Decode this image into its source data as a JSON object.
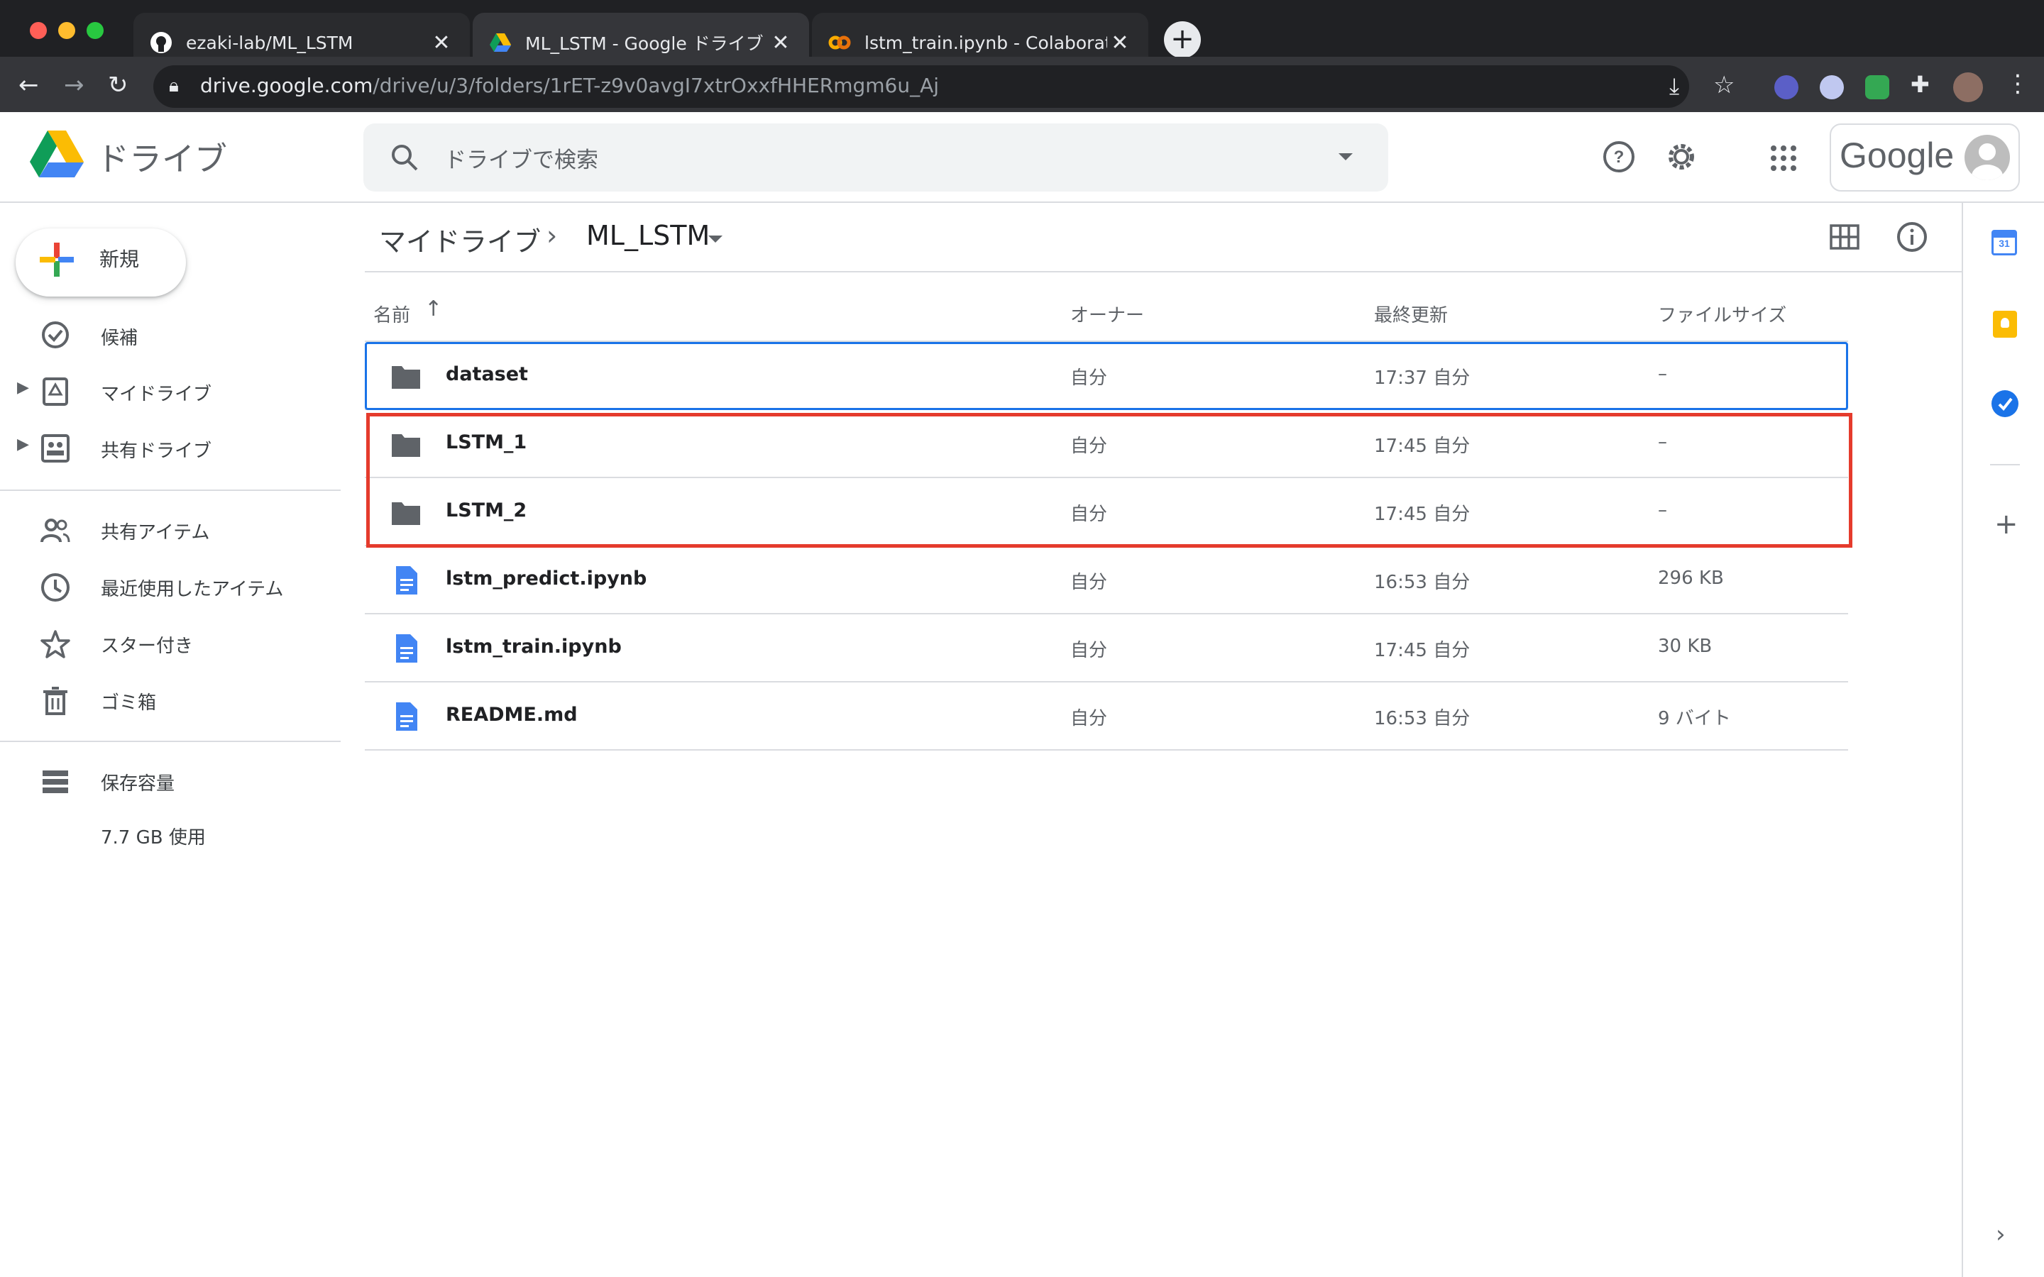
{
  "browser": {
    "tabs": [
      {
        "title": "ezaki-lab/ML_LSTM",
        "icon": "github-icon"
      },
      {
        "title": "ML_LSTM - Google ドライブ",
        "icon": "google-drive-icon"
      },
      {
        "title": "lstm_train.ipynb - Colaboratory",
        "icon": "colab-icon"
      }
    ],
    "url_host": "drive.google.com",
    "url_path": "/drive/u/3/folders/1rET-z9v0avgI7xtrOxxfHHERmgm6u_Aj"
  },
  "drive": {
    "brand": "ドライブ",
    "search_placeholder": "ドライブで検索",
    "account_label": "Google"
  },
  "sidebar": {
    "new_label": "新規",
    "items": [
      {
        "label": "候補",
        "icon": "suggested-icon"
      },
      {
        "label": "マイドライブ",
        "icon": "my-drive-icon"
      },
      {
        "label": "共有ドライブ",
        "icon": "shared-drives-icon"
      },
      {
        "label": "共有アイテム",
        "icon": "shared-with-me-icon"
      },
      {
        "label": "最近使用したアイテム",
        "icon": "recent-icon"
      },
      {
        "label": "スター付き",
        "icon": "star-icon"
      },
      {
        "label": "ゴミ箱",
        "icon": "trash-icon"
      },
      {
        "label": "保存容量",
        "icon": "storage-icon"
      }
    ],
    "storage_used": "7.7 GB 使用"
  },
  "breadcrumb": {
    "root": "マイドライブ",
    "separator": "›",
    "current": "ML_LSTM"
  },
  "table": {
    "columns": {
      "name": "名前",
      "owner": "オーナー",
      "modified": "最終更新",
      "size": "ファイルサイズ"
    },
    "rows": [
      {
        "name": "dataset",
        "type": "folder",
        "owner": "自分",
        "modified": "17:37 自分",
        "size": "–"
      },
      {
        "name": "LSTM_1",
        "type": "folder",
        "owner": "自分",
        "modified": "17:45 自分",
        "size": "–"
      },
      {
        "name": "LSTM_2",
        "type": "folder",
        "owner": "自分",
        "modified": "17:45 自分",
        "size": "–"
      },
      {
        "name": "lstm_predict.ipynb",
        "type": "doc",
        "owner": "自分",
        "modified": "16:53 自分",
        "size": "296 KB"
      },
      {
        "name": "lstm_train.ipynb",
        "type": "doc",
        "owner": "自分",
        "modified": "17:45 自分",
        "size": "30 KB"
      },
      {
        "name": "README.md",
        "type": "doc",
        "owner": "自分",
        "modified": "16:53 自分",
        "size": "9 バイト"
      }
    ]
  },
  "colors": {
    "chrome_dark": "#202124",
    "tab_bg": "#35363a",
    "drive_blue": "#1a73e8",
    "highlight_red": "#e53b2c",
    "folder_gray": "#5f6368",
    "doc_blue": "#4285f4"
  }
}
